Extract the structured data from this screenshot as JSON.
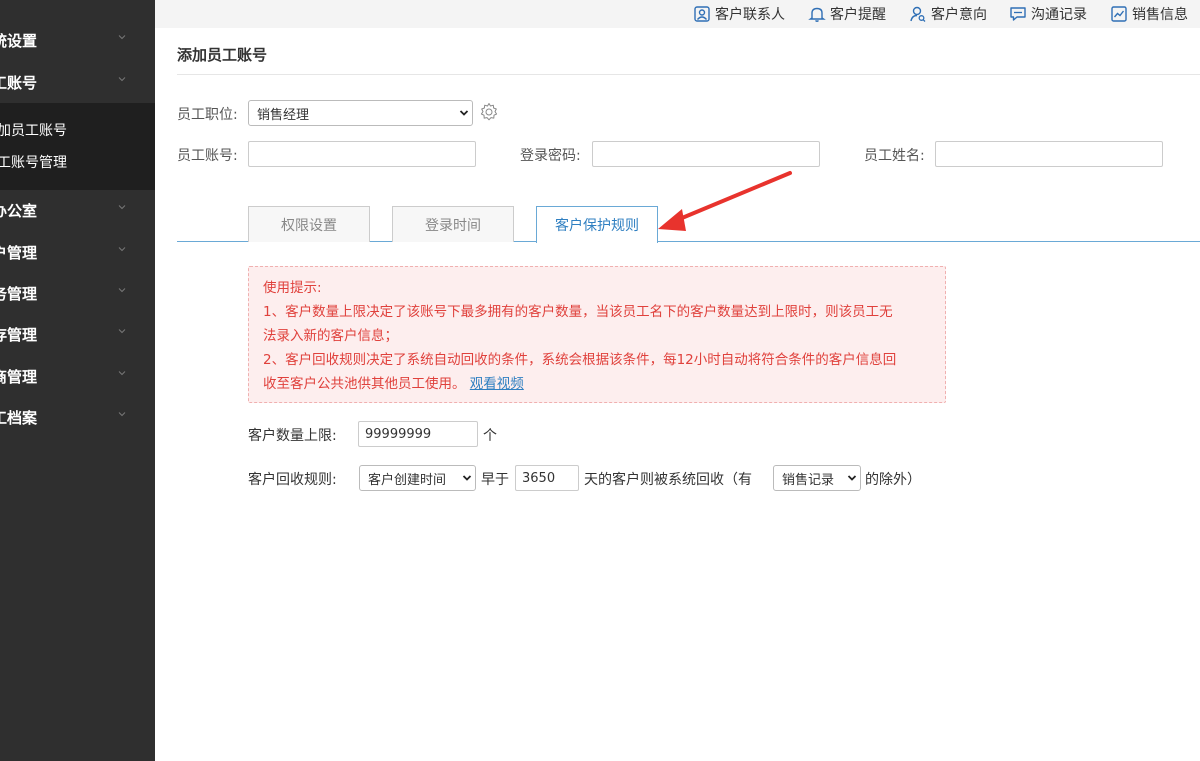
{
  "sidebar": {
    "items": [
      {
        "label": "统设置"
      },
      {
        "label": "工账号"
      },
      {
        "label": "动办公室"
      },
      {
        "label": "户管理"
      },
      {
        "label": "务管理"
      },
      {
        "label": "存管理"
      },
      {
        "label": "应商管理"
      },
      {
        "label": "工档案"
      }
    ],
    "subitems": [
      {
        "label": "加员工账号"
      },
      {
        "label": "工账号管理"
      }
    ]
  },
  "topbar": {
    "links": [
      {
        "label": "客户联系人",
        "icon": "contact-card-icon"
      },
      {
        "label": "客户提醒",
        "icon": "bell-icon"
      },
      {
        "label": "客户意向",
        "icon": "user-search-icon"
      },
      {
        "label": "沟通记录",
        "icon": "chat-icon"
      },
      {
        "label": "销售信息",
        "icon": "chart-icon"
      }
    ]
  },
  "page": {
    "title": "添加员工账号"
  },
  "form": {
    "position_label": "员工职位:",
    "position_value": "销售经理",
    "account_label": "员工账号:",
    "account_value": "",
    "password_label": "登录密码:",
    "password_value": "",
    "name_label": "员工姓名:",
    "name_value": ""
  },
  "tabs": [
    {
      "label": "权限设置",
      "active": false
    },
    {
      "label": "登录时间",
      "active": false
    },
    {
      "label": "客户保护规则",
      "active": true
    }
  ],
  "notice": {
    "heading": "使用提示:",
    "line1": "1、客户数量上限决定了该账号下最多拥有的客户数量，当该员工名下的客户数量达到上限时，则该员工无",
    "line2": "法录入新的客户信息；",
    "line3": "2、客户回收规则决定了系统自动回收的条件，系统会根据该条件，每12小时自动将符合条件的客户信息回",
    "line4": "收至客户公共池供其他员工使用。",
    "link": "观看视频"
  },
  "limit": {
    "label": "客户数量上限:",
    "value": "99999999",
    "unit": "个"
  },
  "recycle": {
    "label": "客户回收规则:",
    "basis_value": "客户创建时间",
    "earlier_than": "早于",
    "days_value": "3650",
    "suffix": "天的客户则被系统回收（有",
    "exception_value": "销售记录",
    "tail": "的除外）"
  },
  "colors": {
    "sidebar_bg": "#2f2f2f",
    "accent": "#2f7fc1",
    "notice_text": "#e0413c",
    "arrow": "#e8332d"
  }
}
